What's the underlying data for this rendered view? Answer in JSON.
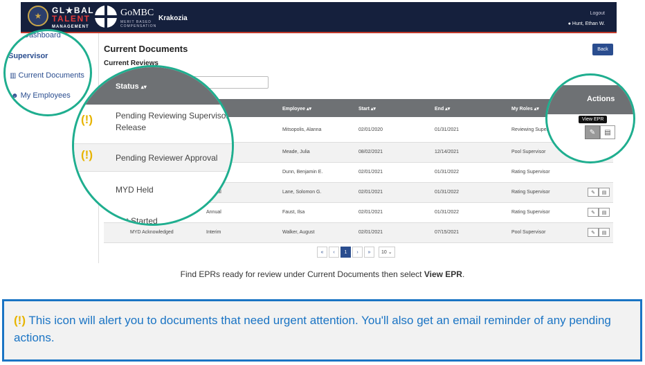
{
  "header": {
    "org_line1": "GL★BAL",
    "org_line2": "TALENT",
    "org_line3": "MANAGEMENT",
    "app_name": "GoMBC",
    "app_sub": "MERIT BASED COMPENSATION",
    "app_context": "Krakozia",
    "logout_label": "Logout",
    "user_name": "Hunt, Ethan W."
  },
  "sidebar": {
    "dashboard_label": "Dashboard",
    "section_label": "Supervisor",
    "items": [
      {
        "label": "Current Documents",
        "icon": "bar-chart-icon"
      },
      {
        "label": "My Employees",
        "icon": "people-icon"
      }
    ]
  },
  "main": {
    "title": "Current Documents",
    "subtitle": "Current Reviews",
    "back_label": "Back",
    "columns": [
      "Status",
      "",
      "Employee",
      "Start",
      "End",
      "My Roles",
      "Actions"
    ],
    "sort_glyph": "▴▾",
    "rows": [
      {
        "status": "Pending Reviewing Supervisor Release",
        "type": "",
        "employee": "Mitsopolis, Alanna",
        "start": "02/01/2020",
        "end": "01/31/2021",
        "role": "Reviewing Supervisor",
        "urgent": true
      },
      {
        "status": "Pending Reviewer Approval",
        "type": "",
        "employee": "Meade, Julia",
        "start": "08/02/2021",
        "end": "12/14/2021",
        "role": "Pool Supervisor",
        "urgent": true
      },
      {
        "status": "",
        "type": "",
        "employee": "Dunn, Benjamin E.",
        "start": "02/01/2021",
        "end": "01/31/2022",
        "role": "Rating Supervisor",
        "urgent": false
      },
      {
        "status": "MYD Held",
        "type": "Annual",
        "employee": "Lane, Solomon G.",
        "start": "02/01/2021",
        "end": "01/31/2022",
        "role": "Rating Supervisor",
        "urgent": false
      },
      {
        "status": "Not Started",
        "type": "Annual",
        "employee": "Faust, Ilsa",
        "start": "02/01/2021",
        "end": "01/31/2022",
        "role": "Rating Supervisor",
        "urgent": false
      },
      {
        "status": "MYD Acknowledged",
        "type": "Interim",
        "employee": "Walker, August",
        "start": "02/01/2021",
        "end": "07/15/2021",
        "role": "Pool Supervisor",
        "urgent": false
      }
    ],
    "tooltip": "View EPR",
    "pager": {
      "first": "«",
      "prev": "‹",
      "current": "1",
      "next": "›",
      "last": "»",
      "page_size": "10"
    }
  },
  "zoom": {
    "status_header": "Status",
    "status_items": [
      "Pending Reviewing Supervisor Release",
      "Pending Reviewer Approval",
      "MYD Held",
      "Not Started"
    ],
    "actions_header": "Actions"
  },
  "caption": {
    "text": "Find EPRs ready for review under Current Documents then select ",
    "bold": "View EPR",
    "tail": "."
  },
  "note": {
    "icon": "(!)",
    "text": "This icon will alert you to documents that need urgent attention. You'll also get an email reminder of any pending actions."
  },
  "colors": {
    "navy": "#15203d",
    "teal": "#1fae8f",
    "blue": "#1a74c4",
    "warn": "#e7b400"
  }
}
